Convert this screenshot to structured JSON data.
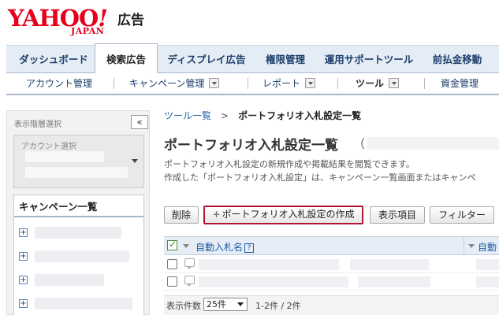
{
  "logo": {
    "main": "YAHOO",
    "bang": "!",
    "sub": "JAPAN",
    "suffix": "広告"
  },
  "main_tabs": [
    "ダッシュボード",
    "検索広告",
    "ディスプレイ広告",
    "権限管理",
    "運用サポートツール",
    "前払金移動"
  ],
  "sub_tabs": [
    "アカウント管理",
    "キャンペーン管理",
    "レポート",
    "ツール",
    "資金管理"
  ],
  "left_panel": {
    "title": "表示階層選択",
    "collapse": "«",
    "account_label": "アカウント選択",
    "campaign_header": "キャンペーン一覧",
    "expand_glyph": "+"
  },
  "breadcrumb": {
    "parent": "ツール一覧",
    "sep": ">",
    "current": "ポートフォリオ入札設定一覧"
  },
  "page_title": "ポートフォリオ入札設定一覧",
  "title_paren": "（",
  "description": [
    "ポートフォリオ入札設定の新規作成や掲載結果を閲覧できます。",
    "作成した「ポートフォリオ入札設定」は、キャンペーン一覧画面またはキャンペ"
  ],
  "actions": {
    "delete": "削除",
    "create_plus": "+",
    "create": "ポートフォリオ入札設定の作成",
    "display_items": "表示項目",
    "filter": "フィルター"
  },
  "table": {
    "column_name": "自動入札名",
    "help": "?",
    "column_name_2": "自動"
  },
  "pager": {
    "label": "表示件数",
    "per_page": "25件",
    "count": "1-2件 / 2件"
  }
}
